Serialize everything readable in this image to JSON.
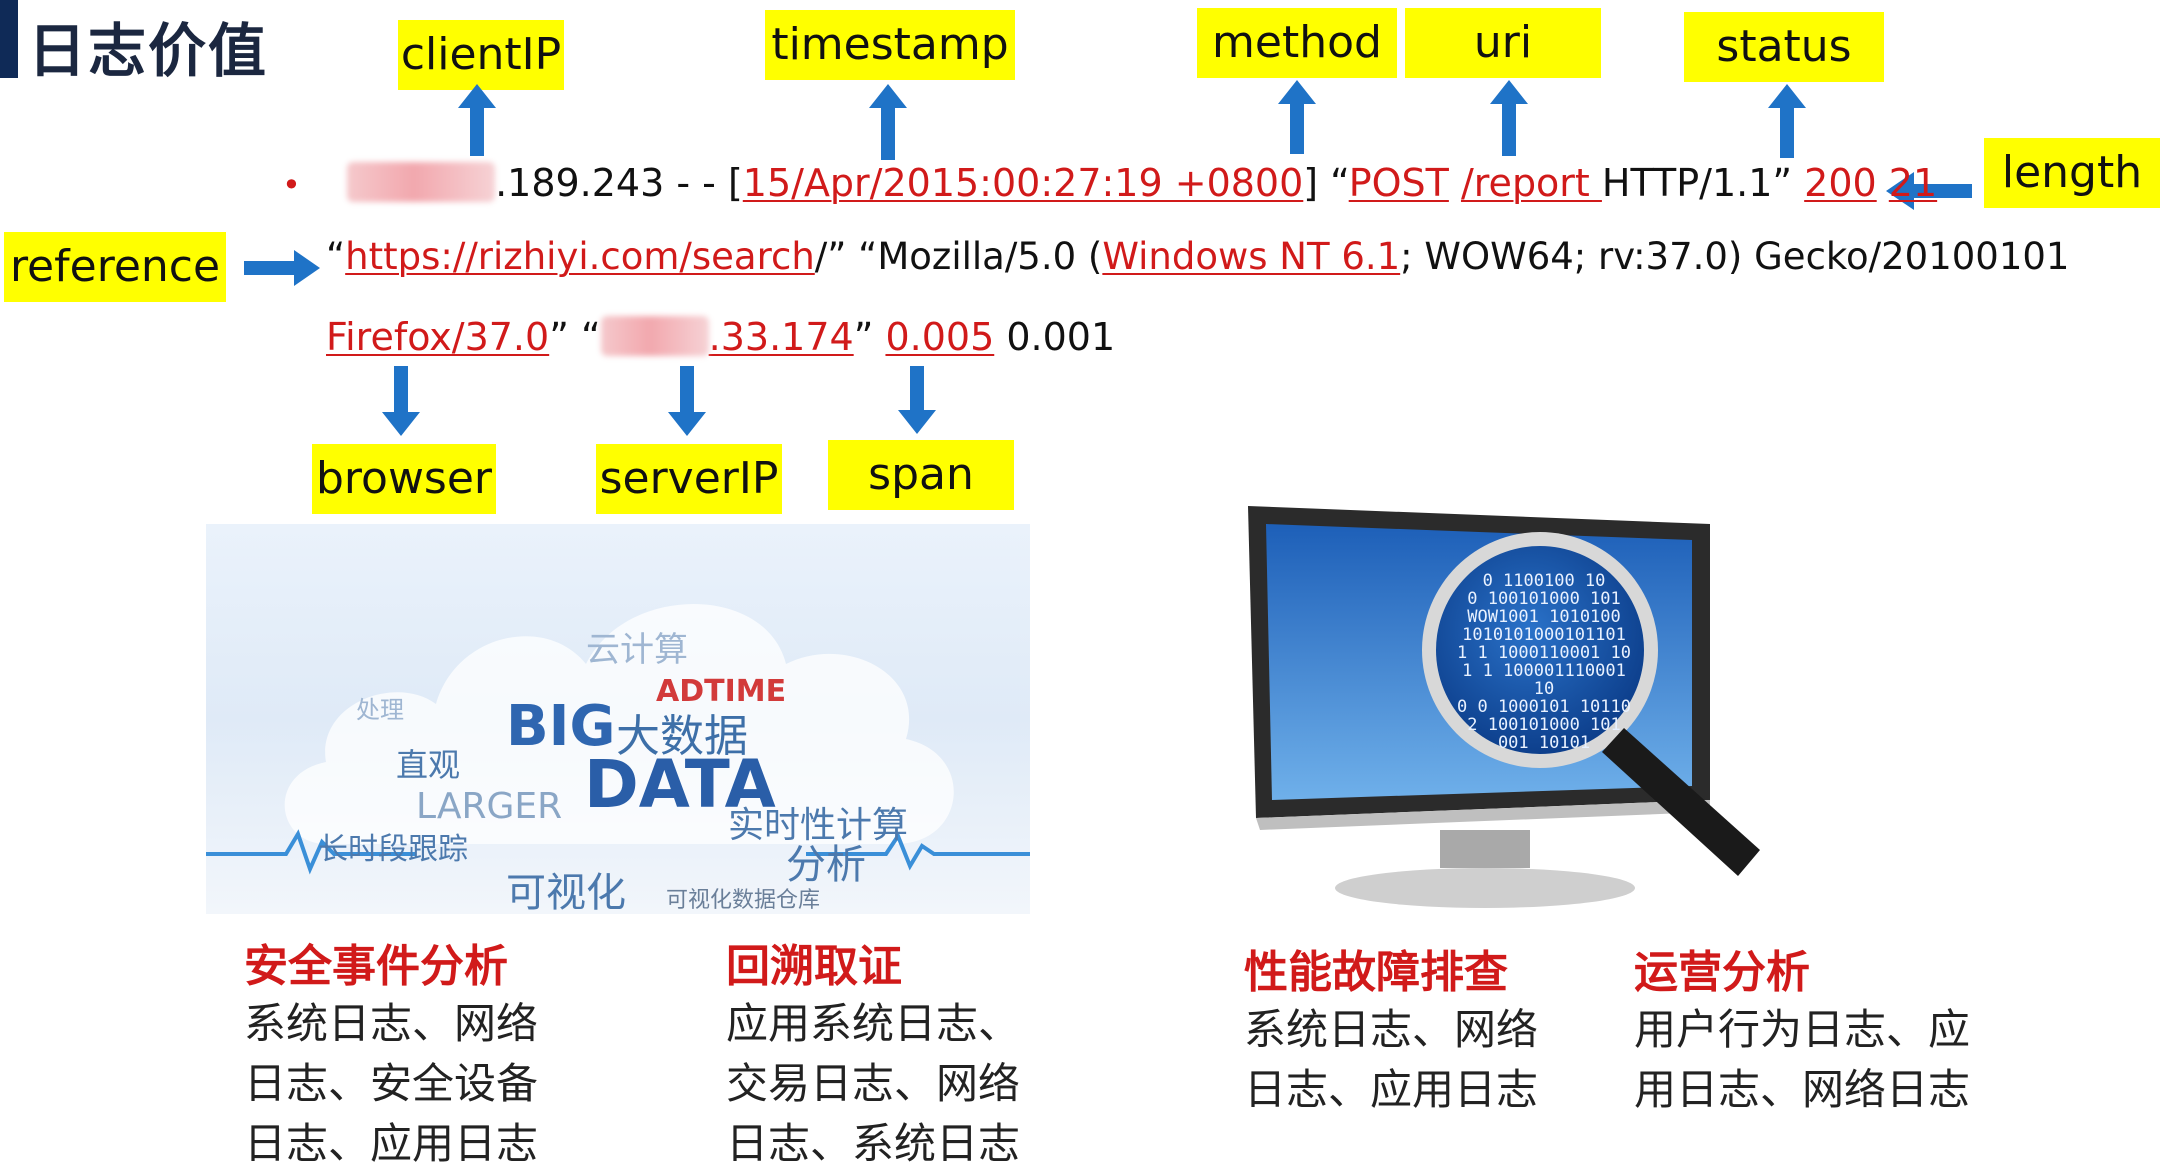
{
  "title": "日志价值",
  "labels": {
    "clientIP": "clientIP",
    "timestamp": "timestamp",
    "method": "method",
    "uri": "uri",
    "status": "status",
    "length": "length",
    "reference": "reference",
    "browser": "browser",
    "serverIP": "serverIP",
    "span": "span"
  },
  "log": {
    "bullet": "•",
    "client_ip_tail": ".189.243",
    "sep1": " - - [",
    "timestamp": "15/Apr/2015:00:27:19 +0800",
    "sep2": "] “",
    "method": "POST",
    "space1": " ",
    "uri": "/report ",
    "protocol": "HTTP/1.1” ",
    "status": "200",
    "space2": " ",
    "length": "21",
    "quote_open": "“",
    "referer": "https://rizhiyi.com/search",
    "after_ref": "/” “Mozilla/5.0 (",
    "os": "Windows NT 6.1",
    "ua_rest": "; WOW64; rv:37.0) Gecko/20100101",
    "browser": "Firefox/37.0",
    "after_browser": "” “",
    "server_ip_tail": ".33.174",
    "after_server": "” ",
    "span": "0.005",
    "tail": " 0.001"
  },
  "bigdata_image": {
    "words": {
      "big": "BIG",
      "dasuju": "大数据",
      "data": "DATA",
      "adtime": "ADTIME",
      "shishi": "实时性计算",
      "fenxi": "分析",
      "keshihua": "可视化",
      "changshi": "长时段跟踪",
      "larger": "LARGER",
      "zhiguan": "直观",
      "yunjisuan": "云计算",
      "chuli": "处理",
      "cangku": "可视化数据仓库"
    }
  },
  "monitor_image": {
    "binary": [
      "0 1100100 10",
      "0 100101000 101",
      "WOW1001 1010100",
      "1010101000101101",
      "1 1 1000110001 10",
      "1 1 100001110001 10",
      "0 0 1000101 10110",
      "2 100101000 101",
      "001 10101"
    ]
  },
  "captions": [
    {
      "title": "安全事件分析",
      "lines": [
        "系统日志、网络",
        "日志、安全设备",
        "日志、应用日志"
      ]
    },
    {
      "title": "回溯取证",
      "lines": [
        "应用系统日志、",
        "交易日志、网络",
        "日志、系统日志"
      ]
    },
    {
      "title": "性能故障排查",
      "lines": [
        "系统日志、网络",
        "日志、应用日志"
      ]
    },
    {
      "title": "运营分析",
      "lines": [
        "用户行为日志、应",
        "用日志、网络日志"
      ]
    }
  ],
  "colors": {
    "tag": "#ffff00",
    "arrow": "#1f73c7",
    "field": "#d11a1a",
    "title_bar": "#0f2a57"
  }
}
